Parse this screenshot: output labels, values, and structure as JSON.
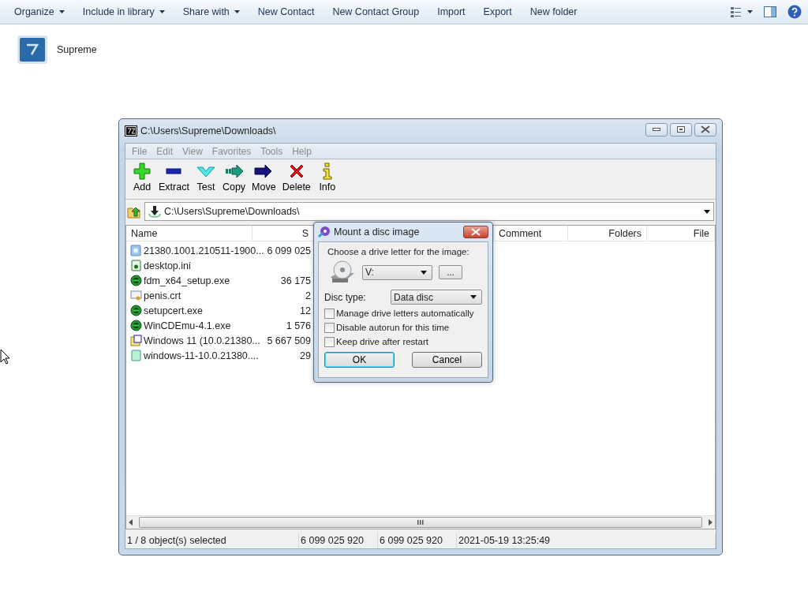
{
  "explorer_toolbar": {
    "items": [
      {
        "label": "Organize",
        "dropdown": true
      },
      {
        "label": "Include in library",
        "dropdown": true
      },
      {
        "label": "Share with",
        "dropdown": true
      },
      {
        "label": "New Contact",
        "dropdown": false
      },
      {
        "label": "New Contact Group",
        "dropdown": false
      },
      {
        "label": "Import",
        "dropdown": false
      },
      {
        "label": "Export",
        "dropdown": false
      },
      {
        "label": "New folder",
        "dropdown": false
      }
    ]
  },
  "explorer_content": {
    "items": [
      {
        "label": "Supreme"
      }
    ]
  },
  "archiver_window": {
    "title": "C:\\Users\\Supreme\\Downloads\\",
    "menu": [
      "File",
      "Edit",
      "View",
      "Favorites",
      "Tools",
      "Help"
    ],
    "toolbar": [
      "Add",
      "Extract",
      "Test",
      "Copy",
      "Move",
      "Delete",
      "Info"
    ],
    "address": "C:\\Users\\Supreme\\Downloads\\",
    "columns": [
      "Name",
      "S",
      "",
      "Comment",
      "Folders",
      "File"
    ],
    "rows": [
      {
        "name": "21380.1001.210511-1900...",
        "size": "6 099 025"
      },
      {
        "name": "desktop.ini",
        "size": ""
      },
      {
        "name": "fdm_x64_setup.exe",
        "size": "36 175"
      },
      {
        "name": "penis.crt",
        "size": "2"
      },
      {
        "name": "setupcert.exe",
        "size": "12"
      },
      {
        "name": "WinCDEmu-4.1.exe",
        "size": "1 576"
      },
      {
        "name": "Windows 11 (10.0.21380...",
        "size": "5 667 509"
      },
      {
        "name": "windows-11-10.0.21380....",
        "size": "29"
      }
    ],
    "status_bar": [
      "1 / 8 object(s) selected",
      "6 099 025 920",
      "6 099 025 920",
      "2021-05-19 13:25:49"
    ]
  },
  "dialog": {
    "title": "Mount a disc image",
    "prompt": "Choose a drive letter for the image:",
    "drive": "V:",
    "browse": "...",
    "disc_type_label": "Disc type:",
    "disc_type": "Data disc",
    "options": [
      {
        "label": "Manage drive letters automatically",
        "checked": false
      },
      {
        "label": "Disable autorun for this time",
        "checked": false
      },
      {
        "label": "Keep drive after restart",
        "checked": false
      }
    ],
    "buttons": [
      "OK",
      "Cancel"
    ]
  }
}
